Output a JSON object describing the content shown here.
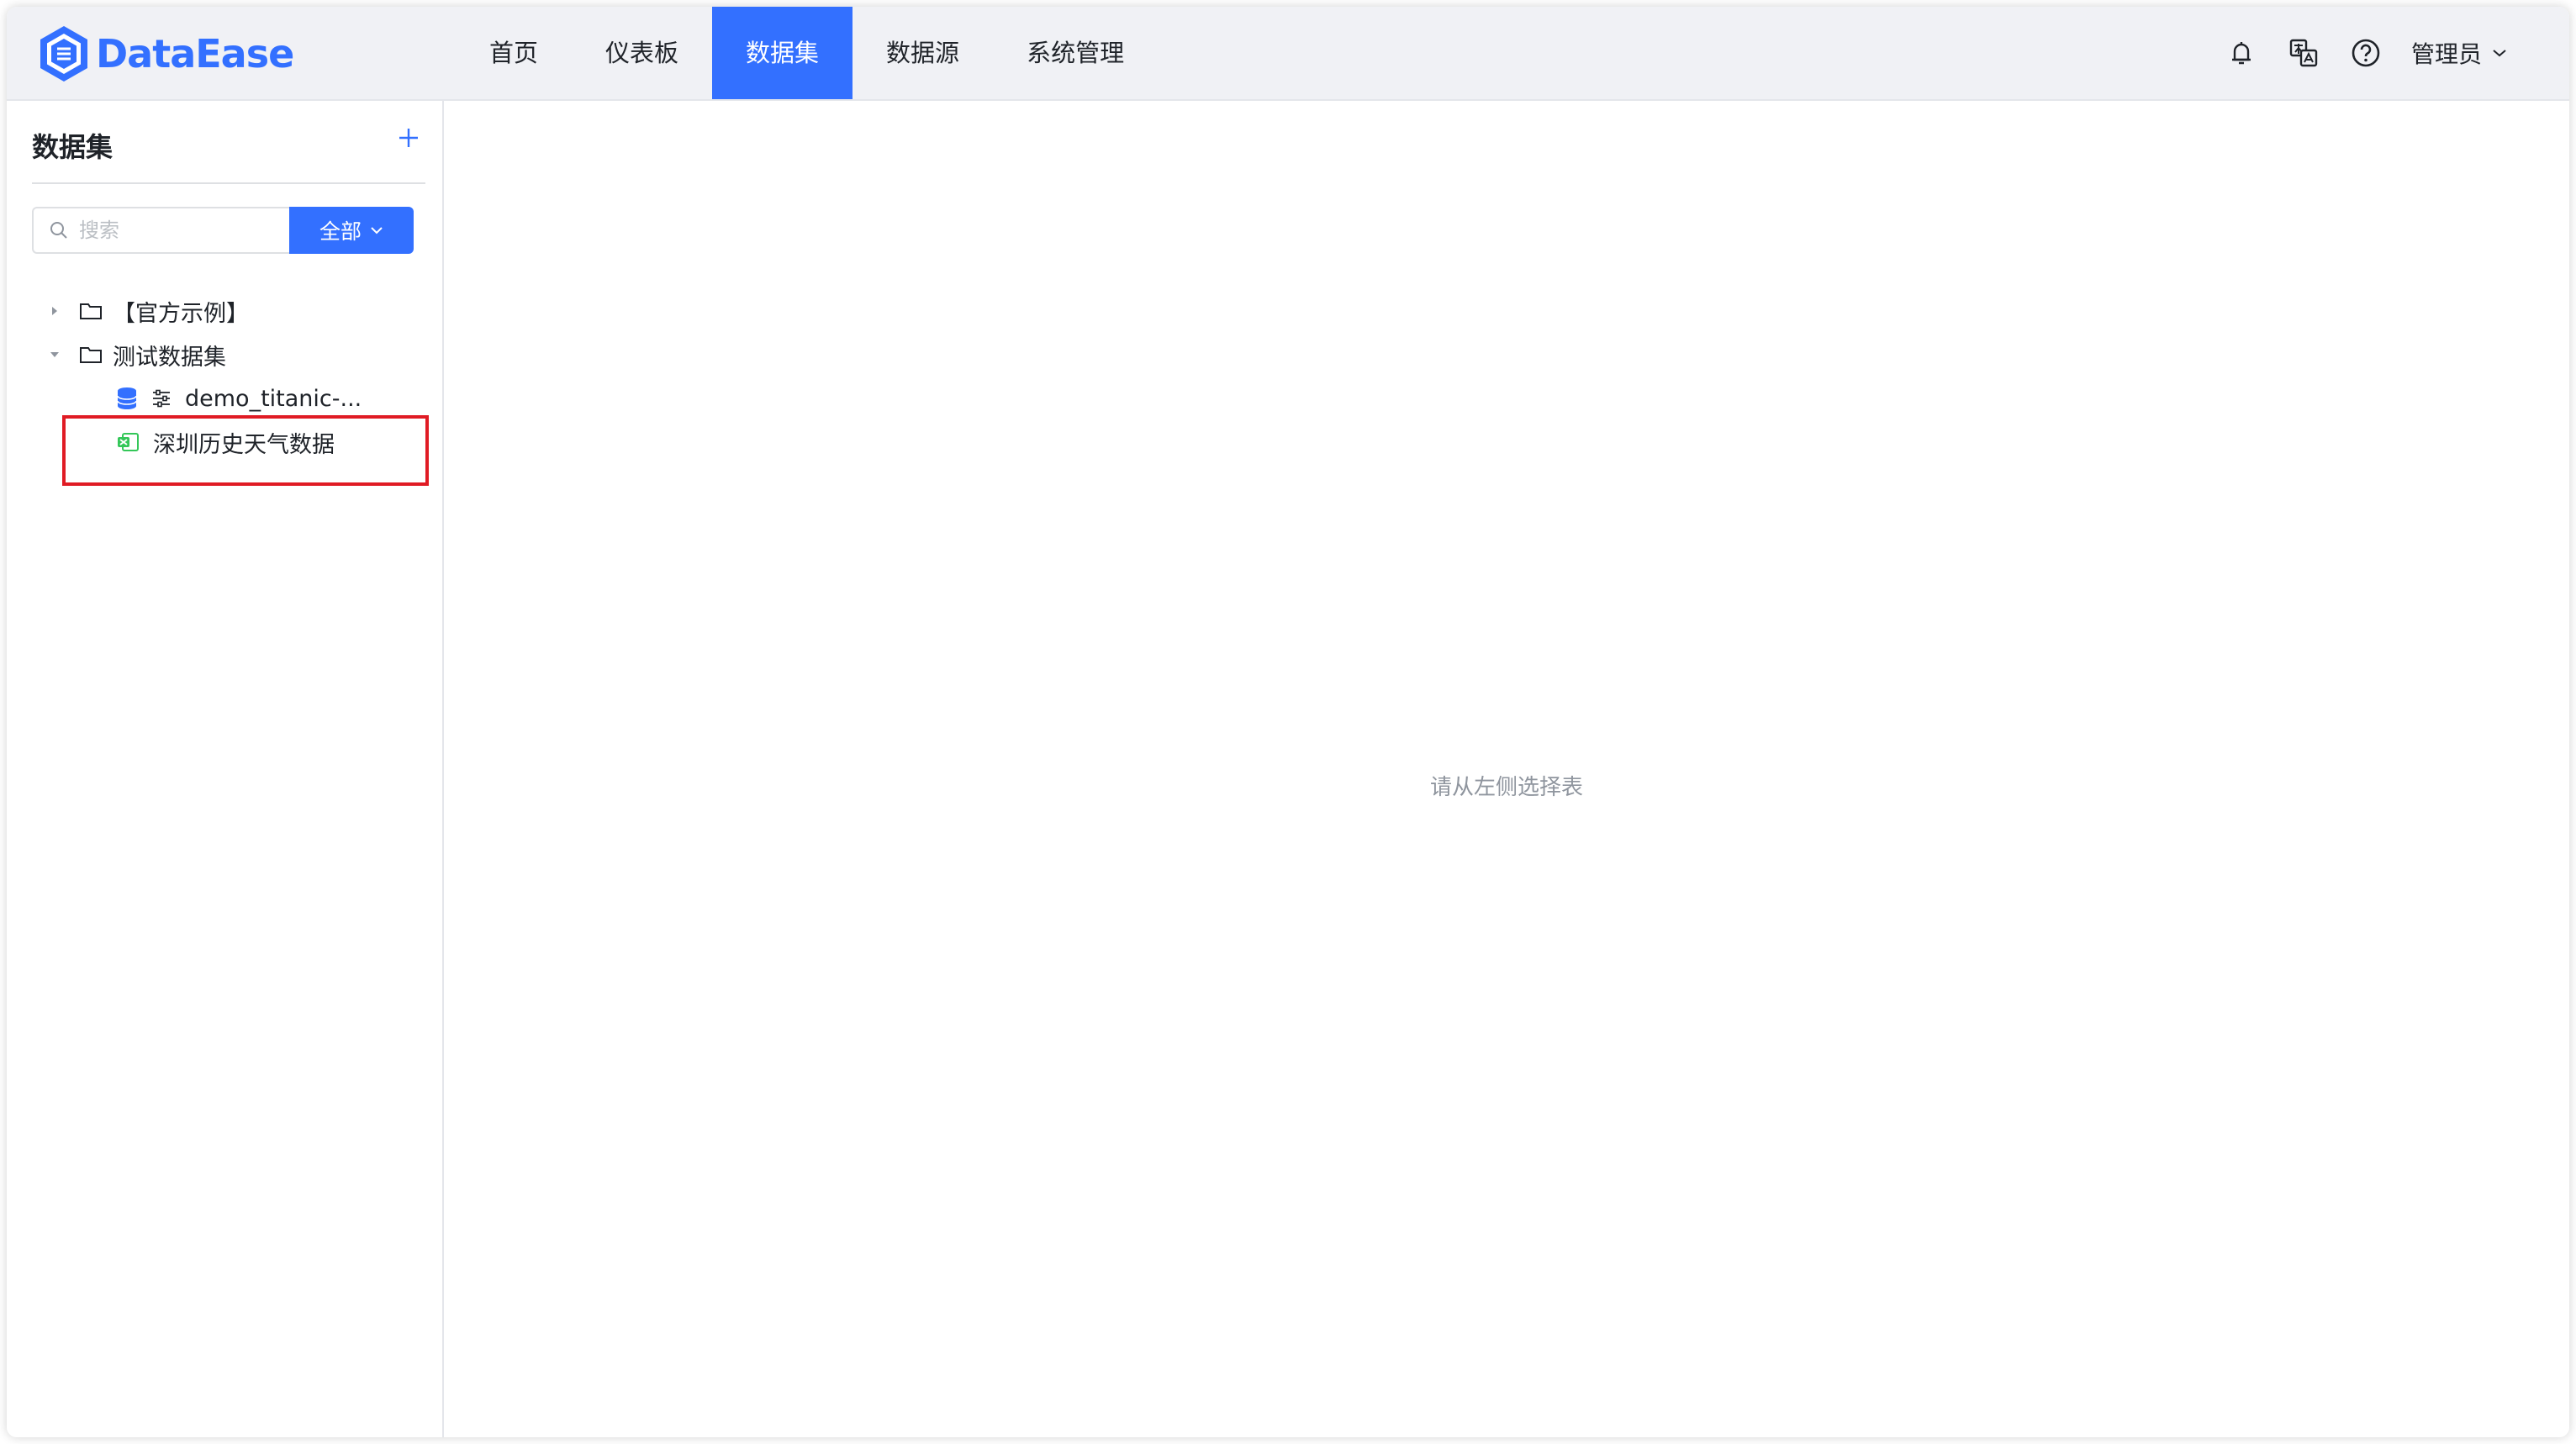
{
  "app": {
    "name": "DataEase",
    "brand_color": "#3370ff"
  },
  "nav": {
    "items": [
      {
        "label": "首页",
        "active": false
      },
      {
        "label": "仪表板",
        "active": false
      },
      {
        "label": "数据集",
        "active": true
      },
      {
        "label": "数据源",
        "active": false
      },
      {
        "label": "系统管理",
        "active": false
      }
    ]
  },
  "header_right": {
    "icons": [
      "notification-bell-icon",
      "translate-icon",
      "help-icon"
    ],
    "user_label": "管理员"
  },
  "sidebar": {
    "title": "数据集",
    "add_icon": "plus-icon",
    "search_placeholder": "搜索",
    "filter_label": "全部",
    "tree": [
      {
        "label": "【官方示例】",
        "type": "folder",
        "expanded": false
      },
      {
        "label": "测试数据集",
        "type": "folder",
        "expanded": true,
        "children": [
          {
            "label": "demo_titanic-...",
            "type": "database-table"
          },
          {
            "label": "深圳历史天气数据",
            "type": "excel-table",
            "highlighted": true
          }
        ]
      }
    ]
  },
  "main": {
    "empty_text": "请从左侧选择表"
  },
  "colors": {
    "highlight_border": "#e01b24",
    "active_nav_bg": "#3370ff"
  }
}
